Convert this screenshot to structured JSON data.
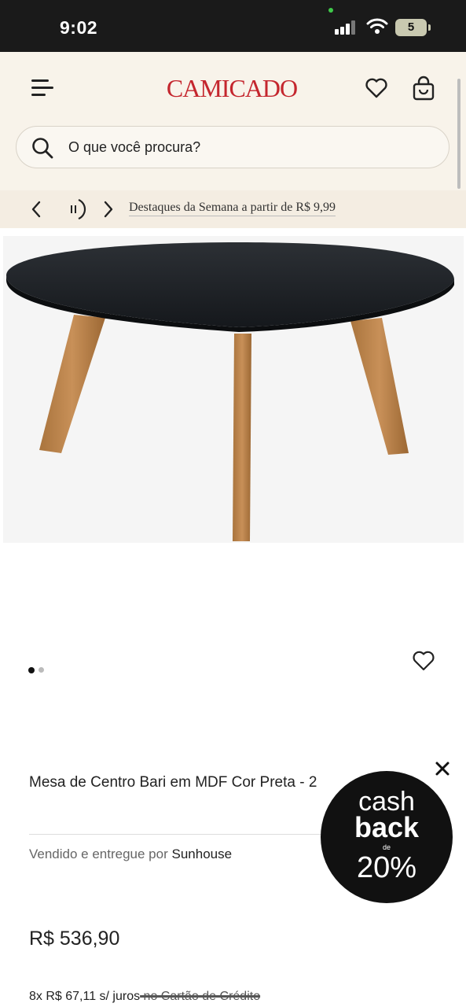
{
  "status_bar": {
    "time": "9:02",
    "battery": "5",
    "icons": [
      "signal-icon",
      "wifi-icon",
      "battery-icon"
    ]
  },
  "header": {
    "logo": "CAMICADO",
    "brand_color": "#c4262e",
    "icons": [
      "menu-icon",
      "heart-icon",
      "bag-icon"
    ]
  },
  "search": {
    "placeholder": "O que você procura?"
  },
  "promo": {
    "text": "Destaques da Semana a partir de R$ 9,99"
  },
  "product": {
    "title": "Mesa de Centro Bari em MDF Cor Preta - 2",
    "seller_label": "Vendido e entregue por",
    "seller_name": "Sunhouse",
    "price": "R$ 536,90",
    "installments": "8x R$ 67,11 s/ juros",
    "installments_suffix": " no Cartão de Crédito",
    "carousel_total": 2,
    "carousel_active": 1
  },
  "cashback": {
    "line1": "cash",
    "line2": "back",
    "line3": "de",
    "percent": "20%"
  }
}
